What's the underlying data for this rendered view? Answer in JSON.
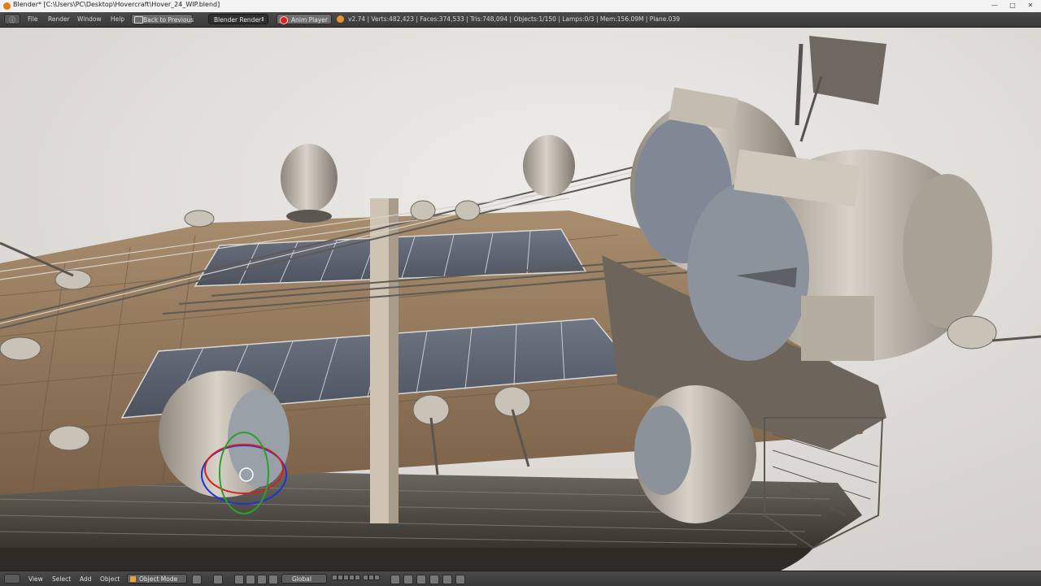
{
  "window": {
    "title": "Blender* [C:\\Users\\PC\\Desktop\\Hovercraft\\Hover_24_WIP.blend]",
    "controls": [
      "minimize",
      "maximize",
      "close"
    ]
  },
  "info_header": {
    "menus": [
      "File",
      "Render",
      "Window",
      "Help"
    ],
    "back_button": "Back to Previous",
    "render_engine": "Blender Render",
    "anim_player": "Anim Player",
    "stats": "v2.74 | Verts:482,423 | Faces:374,533 | Tris:748,094 | Objects:1/150 | Lamps:0/3 | Mem:156.09M | Plane.039"
  },
  "viewport_header": {
    "menus": [
      "View",
      "Select",
      "Add",
      "Object"
    ],
    "mode": "Object Mode",
    "orientation": "Global"
  },
  "colors": {
    "info_bg": "#3f3f3f",
    "sky": "#e3e1de",
    "deck": "#93785c",
    "metal": "#b7b0a6",
    "accent": "#e87d0d"
  },
  "icons": [
    "blender-logo-icon",
    "editor-type-icon",
    "screen-back-icon",
    "record-icon",
    "stats-blender-icon",
    "view3d-icon",
    "object-mode-cube-icon",
    "pivot-icon",
    "manipulator-icons",
    "layer-boxes"
  ]
}
